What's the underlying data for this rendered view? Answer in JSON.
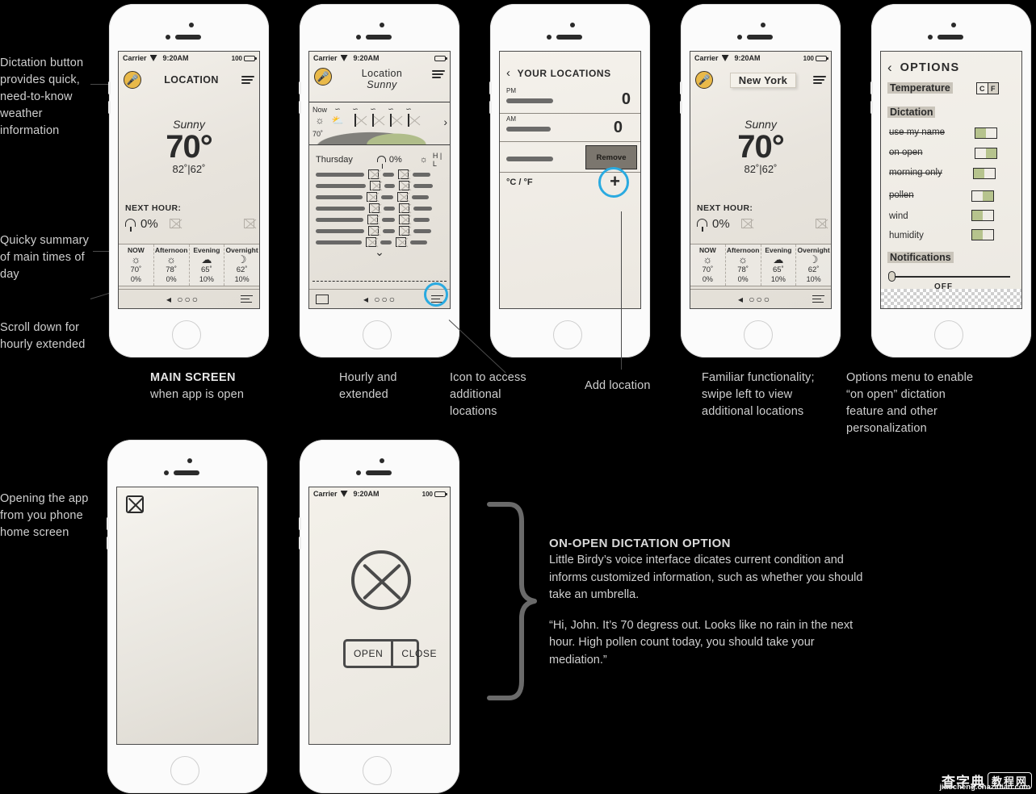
{
  "annotations": {
    "left": [
      {
        "text": "Dictation button provides quick, need-to-know weather information"
      },
      {
        "text": "Quicky summary of main times of day"
      },
      {
        "text": "Scroll down for hourly extended"
      },
      {
        "text": "Opening the app from you phone home screen"
      }
    ]
  },
  "captions": {
    "main_screen_title": "MAIN SCREEN",
    "main_screen_sub": "when app is open",
    "hourly_extended": "Hourly and extended",
    "icon_access": "Icon to access additional locations",
    "add_location": "Add location",
    "familiar": "Familiar functionality; swipe left to view additional locations",
    "options_menu": "Options menu to enable “on open” dictation feature and other personalization"
  },
  "dictation_block": {
    "title": "ON-OPEN DICTATION OPTION",
    "paragraph": "Little Birdy’s voice interface dicates current condition and informs customized information, such as whether you should take an umbrella.",
    "quote": "“Hi, John. It’s 70 degress out. Looks like no rain in the next hour. High pollen count today, you should take your mediation.”"
  },
  "status_bar": {
    "carrier": "Carrier",
    "time": "9:20AM",
    "battery": "100"
  },
  "phone1": {
    "header_title": "LOCATION",
    "mic_icon": "microphone-icon",
    "menu_icon": "hamburger-icon",
    "condition": "Sunny",
    "temp": "70°",
    "high_low": "82˚|62˚",
    "next_hour_label": "NEXT HOUR:",
    "next_hour_pct": "0%",
    "columns": [
      {
        "label": "NOW",
        "icon": "☼",
        "temp": "70˚",
        "precip": "0%"
      },
      {
        "label": "Afternoon",
        "icon": "☼",
        "temp": "78˚",
        "precip": "0%"
      },
      {
        "label": "Evening",
        "icon": "☁",
        "temp": "65˚",
        "precip": "10%"
      },
      {
        "label": "Overnight",
        "icon": "☽",
        "temp": "62˚",
        "precip": "10%"
      }
    ],
    "tabbar_dots": "◂ ○○○",
    "tabbar_list": "list-icon"
  },
  "phone2": {
    "header_title": "Location",
    "header_sub": "Sunny",
    "hourly_label": "Now",
    "hourly_temp": "70˚",
    "chevron": "›",
    "extended_day": "Thursday",
    "extended_precip": "0%",
    "extended_hl": "H | L",
    "scroll_chevron": "⌄",
    "highlight": "hamburger-icon-highlight"
  },
  "phone3": {
    "back": "‹",
    "title": "YOUR LOCATIONS",
    "rows": [
      {
        "meta": "PM"
      },
      {
        "meta": "AM"
      },
      {
        "meta": ""
      }
    ],
    "remove_label": "Remove",
    "unit_toggle": "°C / °F",
    "add_label": "+"
  },
  "phone4": {
    "header_title": "New York",
    "condition": "Sunny",
    "temp": "70°",
    "high_low": "82˚|62˚",
    "next_hour_label": "NEXT HOUR:",
    "next_hour_pct": "0%",
    "columns": [
      {
        "label": "NOW",
        "icon": "☼",
        "temp": "70˚",
        "precip": "0%"
      },
      {
        "label": "Afternoon",
        "icon": "☼",
        "temp": "78˚",
        "precip": "0%"
      },
      {
        "label": "Evening",
        "icon": "☁",
        "temp": "65˚",
        "precip": "10%"
      },
      {
        "label": "Overnight",
        "icon": "☽",
        "temp": "62˚",
        "precip": "10%"
      }
    ]
  },
  "phone5": {
    "back": "‹",
    "title": "OPTIONS",
    "temperature_label": "Temperature",
    "unit_c": "C",
    "unit_f": "F",
    "dictation_label": "Dictation",
    "items": [
      {
        "label": "use my name",
        "state": "left"
      },
      {
        "label": "on open",
        "state": "right"
      },
      {
        "label": "morning only",
        "state": "left"
      },
      {
        "label": "pollen",
        "state": "right"
      },
      {
        "label": "wind",
        "state": "left"
      },
      {
        "label": "humidity",
        "state": "left"
      }
    ],
    "notifications_label": "Notifications",
    "notifications_state": "OFF"
  },
  "phone6": {
    "app_icon": "app-icon"
  },
  "phone7": {
    "logo_icon": "crossed-circle-logo",
    "open_label": "OPEN",
    "close_label": "CLOSE"
  },
  "watermark": {
    "cn": "查字典",
    "box": "教程网",
    "url": "jiaocheng.chazidian.com"
  },
  "colors": {
    "background": "#000000",
    "highlight": "#2aaae0",
    "mic_accent": "#e9b949",
    "toggle_on": "#b6c38d",
    "paper": "#e9e6e0"
  }
}
